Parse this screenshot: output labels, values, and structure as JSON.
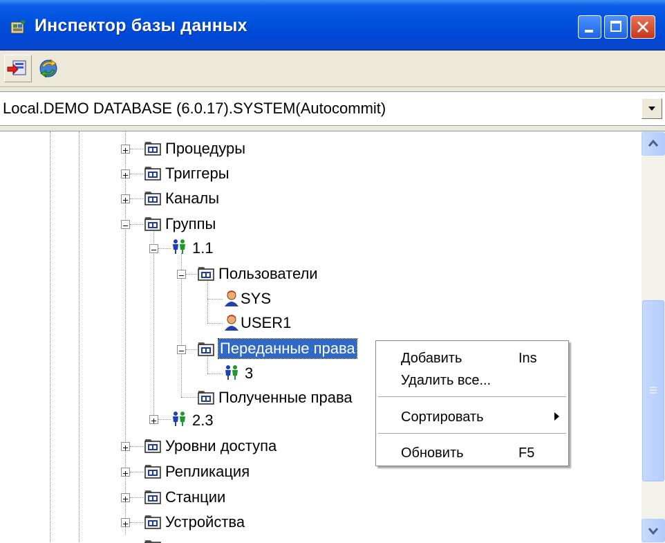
{
  "window": {
    "title": "Инспектор базы данных"
  },
  "connection": {
    "value": "Local.DEMO DATABASE (6.0.17).SYSTEM(Autocommit)"
  },
  "tree": {
    "nodes": [
      {
        "label": "Процедуры"
      },
      {
        "label": "Триггеры"
      },
      {
        "label": "Каналы"
      },
      {
        "label": "Группы"
      },
      {
        "label": "1.1"
      },
      {
        "label": "Пользователи"
      },
      {
        "label": "SYS"
      },
      {
        "label": "USER1"
      },
      {
        "label": "Переданные права"
      },
      {
        "label": "3"
      },
      {
        "label": "Полученные права"
      },
      {
        "label": "2.3"
      },
      {
        "label": "Уровни доступа"
      },
      {
        "label": "Репликация"
      },
      {
        "label": "Станции"
      },
      {
        "label": "Устройства"
      }
    ]
  },
  "context_menu": {
    "items": [
      {
        "label": "Добавить",
        "shortcut": "Ins"
      },
      {
        "label": "Удалить все..."
      },
      {
        "label": "Сортировать"
      },
      {
        "label": "Обновить",
        "shortcut": "F5"
      }
    ]
  },
  "colors": {
    "titlebar": "#0050dc",
    "selection": "#316ac5",
    "close_button": "#c8361a"
  }
}
